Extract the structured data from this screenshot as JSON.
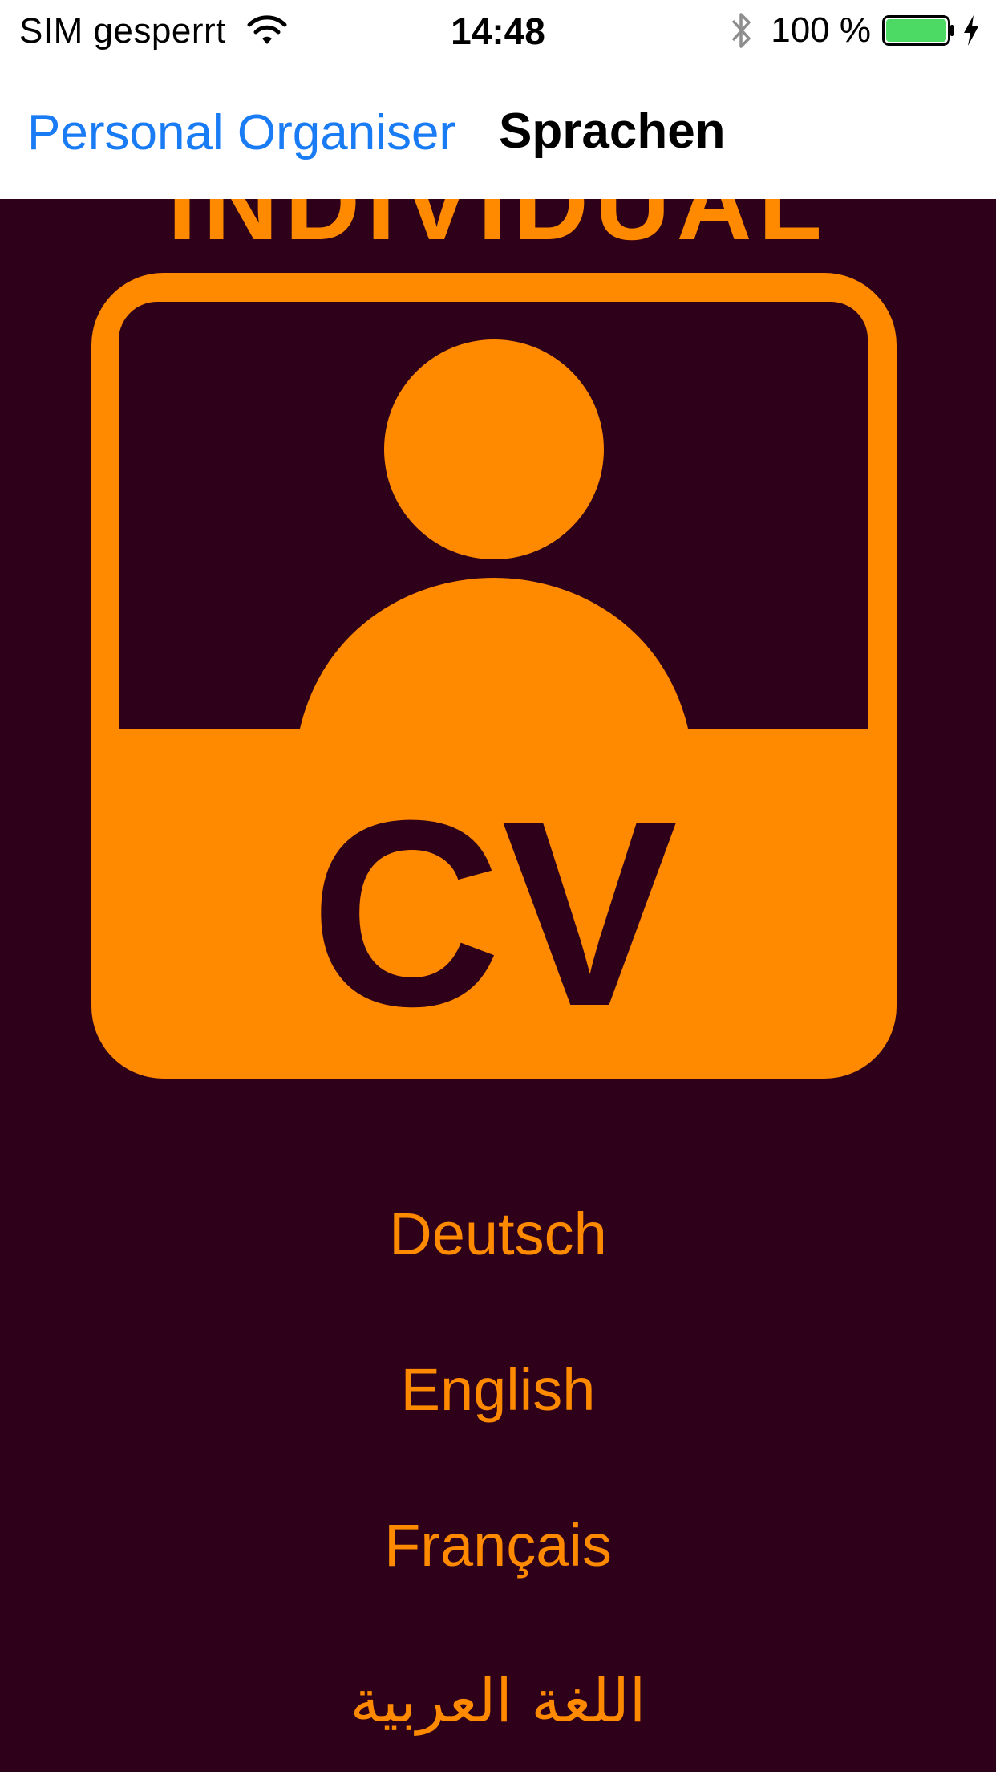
{
  "status": {
    "carrier": "SIM gesperrt",
    "time": "14:48",
    "battery_percent": "100 %",
    "battery_level": 1.0,
    "icons": [
      "wifi-icon",
      "bluetooth-icon",
      "battery-icon",
      "charging-icon"
    ]
  },
  "nav": {
    "back_label": "Personal Organiser",
    "title": "Sprachen"
  },
  "content": {
    "heading": "INDIVIDUAL",
    "logo_text": "CV",
    "languages": [
      {
        "label": "Deutsch"
      },
      {
        "label": "English"
      },
      {
        "label": "Français"
      },
      {
        "label": "اللغة العربية"
      }
    ]
  },
  "colors": {
    "background": "#2e0019",
    "accent": "#ff8a00",
    "link": "#1a7cf5",
    "battery": "#4cd964"
  }
}
